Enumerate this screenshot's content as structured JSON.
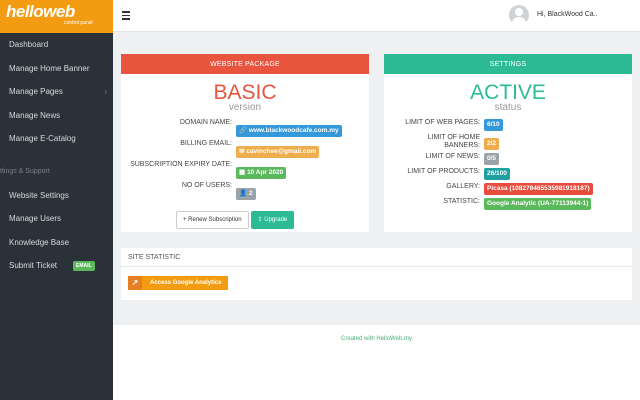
{
  "logo": {
    "main": "helloweb",
    "sub": "control panel"
  },
  "sidebar": {
    "items": [
      {
        "label": "Dashboard"
      },
      {
        "label": "Manage Home Banner"
      },
      {
        "label": "Manage Pages",
        "chevron": "›"
      },
      {
        "label": "Manage News"
      },
      {
        "label": "Manage E-Catalog"
      }
    ],
    "section_label": "ttings & Support",
    "support_items": [
      {
        "label": "Website Settings"
      },
      {
        "label": "Manage Users"
      },
      {
        "label": "Knowledge Base"
      },
      {
        "label": "Submit Ticket",
        "badge": "EMAIL"
      }
    ]
  },
  "header": {
    "user_greeting": "Hi, BlackWood Ca.."
  },
  "package": {
    "heading": "WEBSITE PACKAGE",
    "title": "BASIC",
    "subtitle": "version",
    "rows": [
      {
        "label": "DOMAIN NAME:",
        "value": "www.blackwoodcafe.com.my",
        "icon": "link-icon",
        "color": "#3498db"
      },
      {
        "label": "BILLING EMAIL:",
        "value": "cavinchee@gmail.com",
        "icon": "envelope-icon",
        "color": "#f0ad4e"
      },
      {
        "label": "SUBSCRIPTION EXPIRY DATE:",
        "value": "10 Apr 2020",
        "icon": "calendar-icon",
        "color": "#5cb85c"
      },
      {
        "label": "NO OF USERS:",
        "value": "2",
        "icon": "user-icon",
        "color": "#9aa3a9"
      }
    ],
    "renew_label": "+ Renew Subscription",
    "upgrade_label": "Upgrade"
  },
  "settings": {
    "heading": "SETTINGS",
    "title": "ACTIVE",
    "subtitle": "status",
    "rows": [
      {
        "label": "LIMIT OF WEB PAGES:",
        "value": "6/10",
        "color": "#3498db"
      },
      {
        "label": "LIMIT OF HOME BANNERS:",
        "value": "2/2",
        "color": "#f0ad4e"
      },
      {
        "label": "LIMIT OF NEWS:",
        "value": "0/5",
        "color": "#9aa3a9"
      },
      {
        "label": "LIMIT OF PRODUCTS:",
        "value": "26/100",
        "color": "#20a0a0"
      },
      {
        "label": "GALLERY:",
        "value": "Picasa (108278465535981918187)",
        "color": "#e74c3c"
      },
      {
        "label": "STATISTIC:",
        "value": "Google Analytic (UA-77113944-1)",
        "color": "#5cb85c"
      }
    ]
  },
  "site_statistic": {
    "heading": "SITE STATISTIC",
    "button_label": "Access Google Analytics"
  },
  "footer": {
    "text": "Created with HelloWeb.my"
  },
  "colors": {
    "package_head": "#e8543d",
    "settings_head": "#2dbb96",
    "accent_orange": "#f39c12"
  }
}
